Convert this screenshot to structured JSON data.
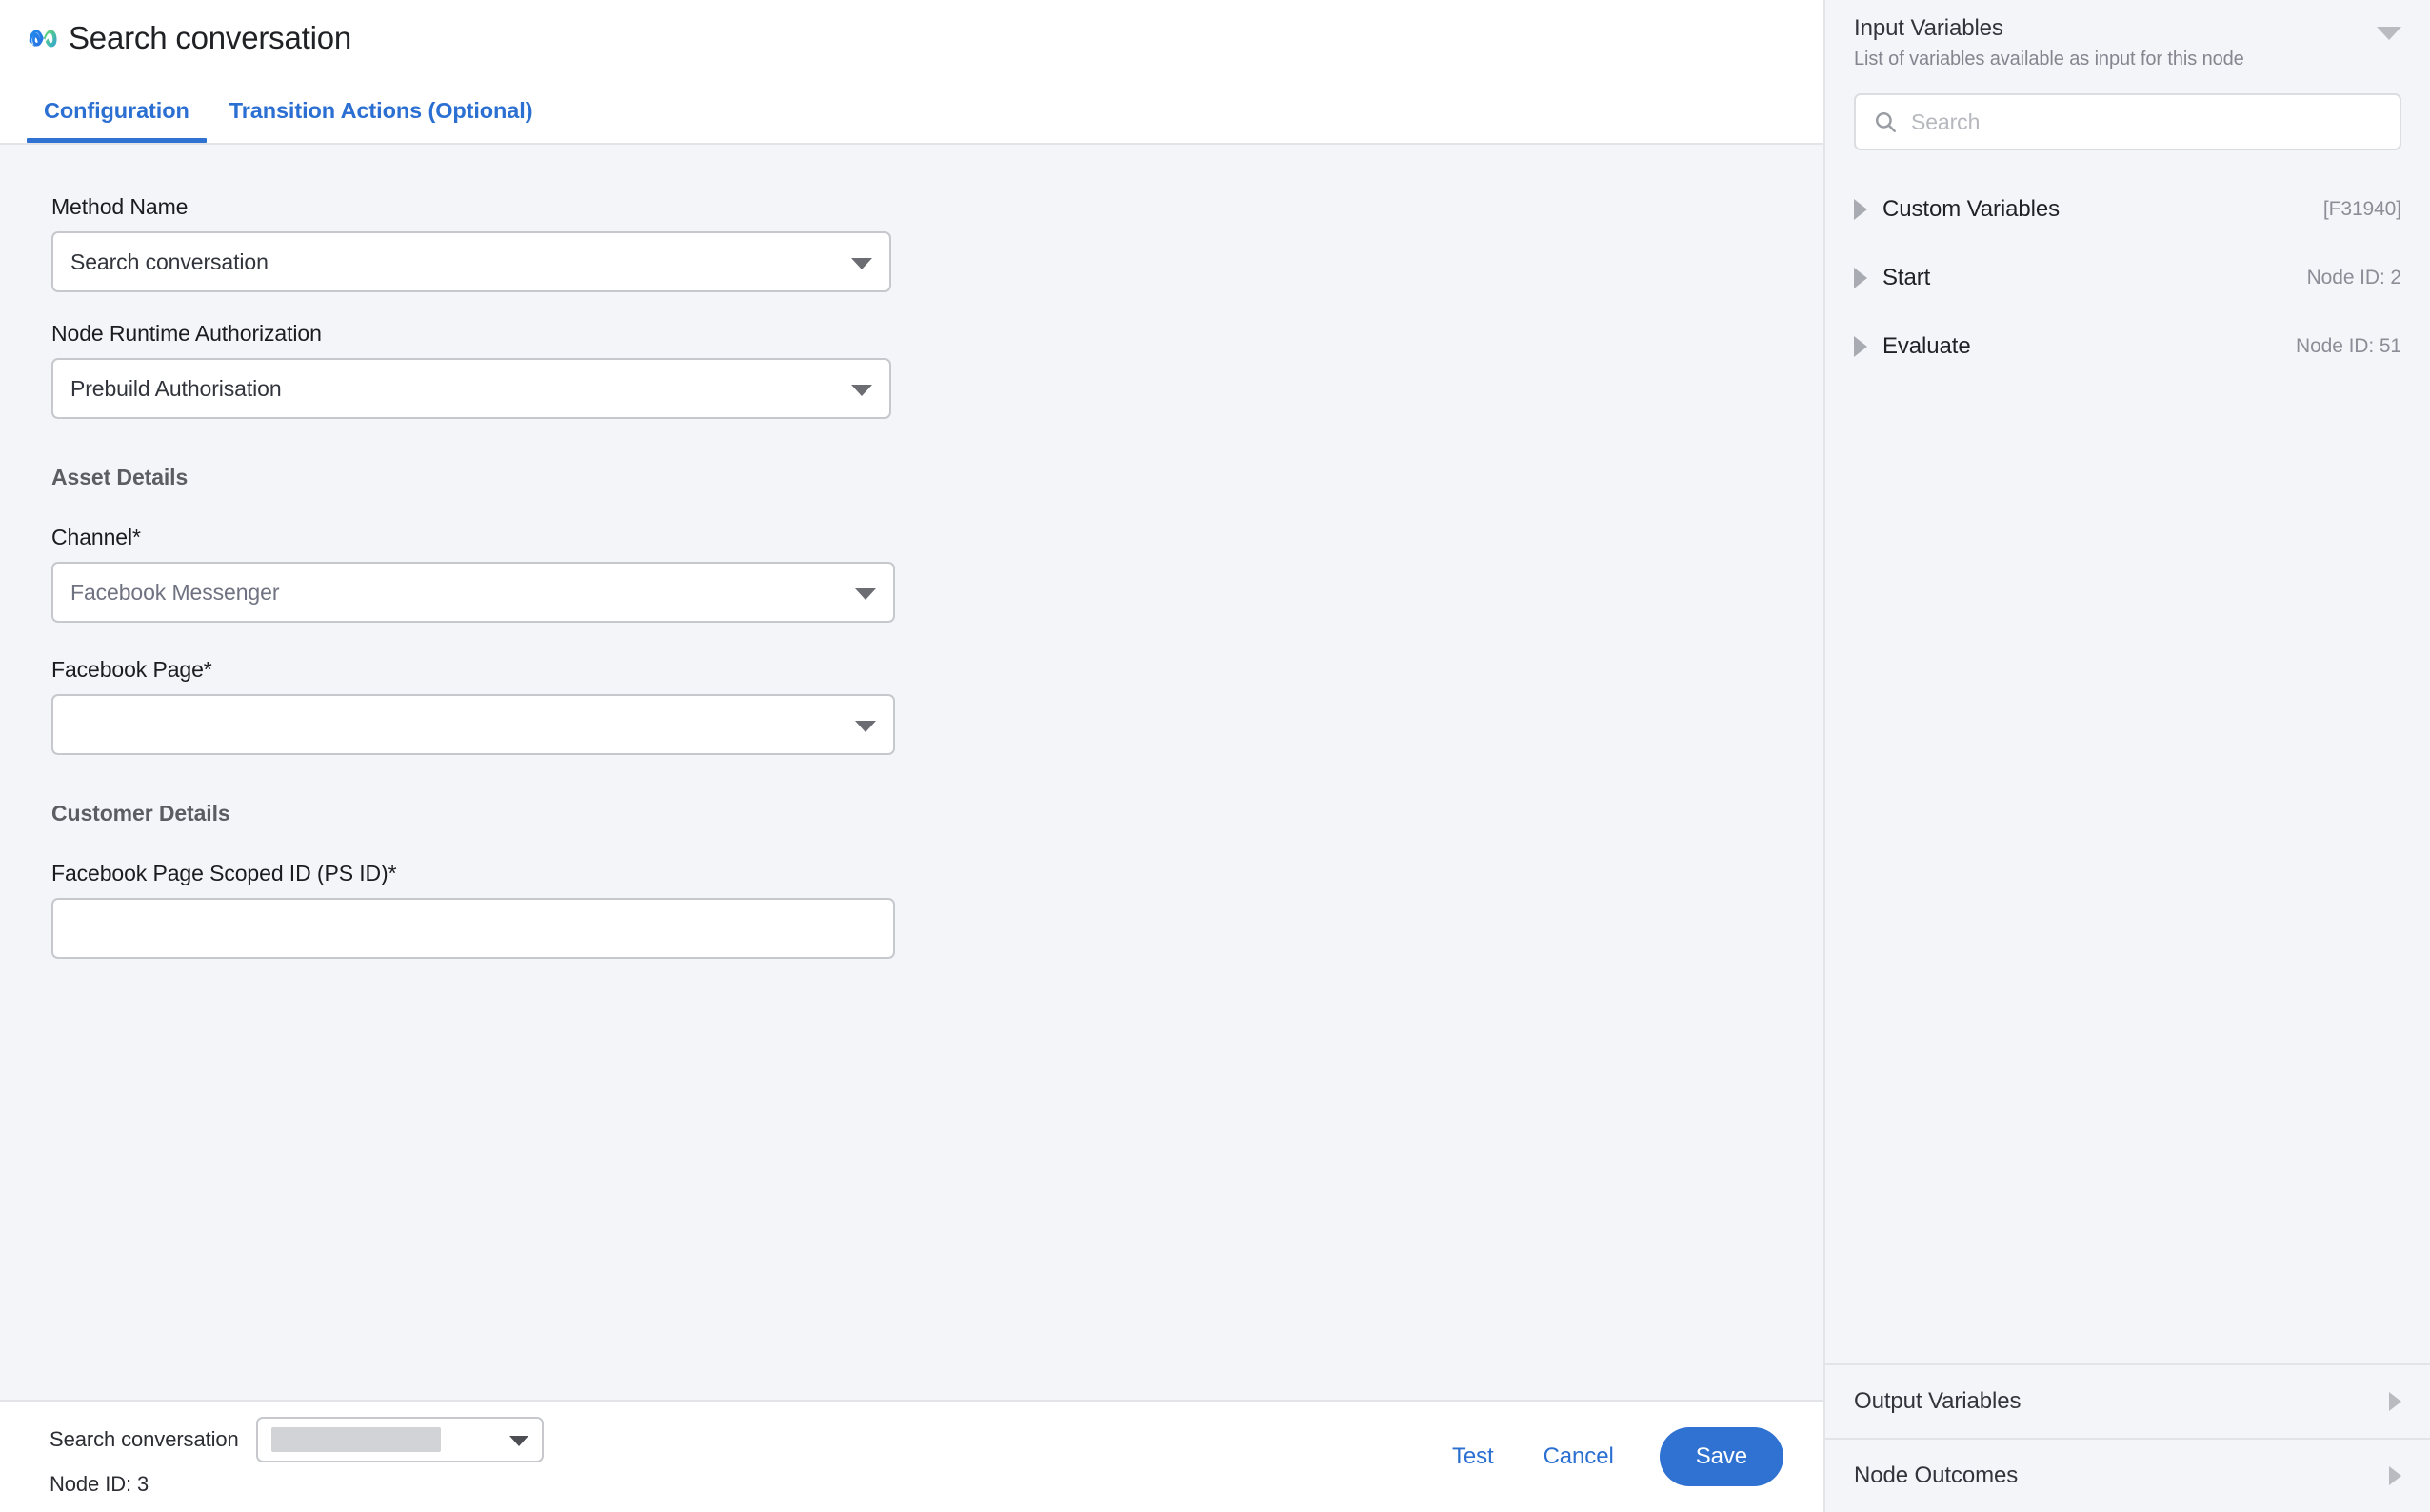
{
  "header": {
    "logo_icon": "meta-infinity-logo",
    "title": "Search conversation",
    "tabs": [
      {
        "label": "Configuration",
        "active": true
      },
      {
        "label": "Transition Actions (Optional)",
        "active": false
      }
    ]
  },
  "form": {
    "method_name": {
      "label": "Method Name",
      "value": "Search conversation"
    },
    "node_runtime_auth": {
      "label": "Node Runtime Authorization",
      "value": "Prebuild Authorisation"
    },
    "asset_details": {
      "heading": "Asset Details",
      "channel": {
        "label": "Channel*",
        "value": "Facebook Messenger"
      },
      "facebook_page": {
        "label": "Facebook Page*",
        "value": ""
      }
    },
    "customer_details": {
      "heading": "Customer Details",
      "ps_id": {
        "label": "Facebook Page Scoped ID (PS ID)*",
        "value": ""
      }
    }
  },
  "footer": {
    "node_name": "Search conversation",
    "node_id": "Node ID: 3",
    "outcome_select_value": "",
    "test_label": "Test",
    "cancel_label": "Cancel",
    "save_label": "Save"
  },
  "sidebar": {
    "title": "Input Variables",
    "subtitle": "List of variables available as input for this node",
    "search": {
      "placeholder": "Search",
      "value": ""
    },
    "variables": [
      {
        "name": "Custom Variables",
        "id": "[F31940]"
      },
      {
        "name": "Start",
        "id": "Node ID: 2"
      },
      {
        "name": "Evaluate",
        "id": "Node ID: 51"
      }
    ],
    "collapsed_sections": [
      {
        "label": "Output Variables"
      },
      {
        "label": "Node Outcomes"
      }
    ]
  },
  "colors": {
    "accent_blue": "#2f72d1",
    "panel_bg": "#f4f5f9",
    "border": "#c6c8cd"
  }
}
